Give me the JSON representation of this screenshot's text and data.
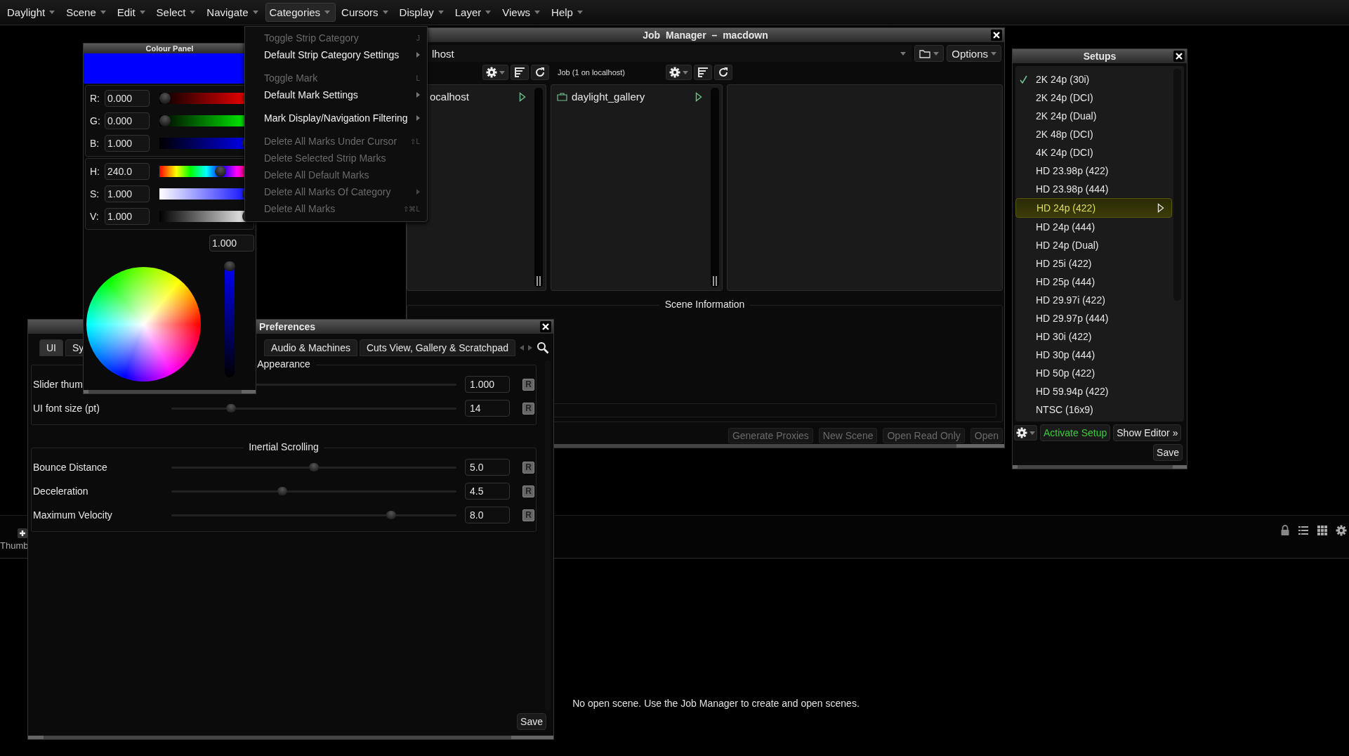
{
  "menubar": [
    {
      "label": "Daylight",
      "open": false
    },
    {
      "label": "Scene",
      "open": false
    },
    {
      "label": "Edit",
      "open": false
    },
    {
      "label": "Select",
      "open": false
    },
    {
      "label": "Navigate",
      "open": false
    },
    {
      "label": "Categories",
      "open": true
    },
    {
      "label": "Cursors",
      "open": false
    },
    {
      "label": "Display",
      "open": false
    },
    {
      "label": "Layer",
      "open": false
    },
    {
      "label": "Views",
      "open": false
    },
    {
      "label": "Help",
      "open": false
    }
  ],
  "categories_menu": {
    "items": [
      {
        "kind": "item",
        "label": "Toggle Strip Category",
        "disabled": true,
        "submenu": false,
        "shortcut": "J"
      },
      {
        "kind": "item",
        "label": "Default Strip Category Settings",
        "disabled": false,
        "submenu": true
      },
      {
        "kind": "separator"
      },
      {
        "kind": "item",
        "label": "Toggle Mark",
        "disabled": true,
        "submenu": false,
        "shortcut": "L"
      },
      {
        "kind": "item",
        "label": "Default Mark Settings",
        "disabled": false,
        "submenu": true
      },
      {
        "kind": "separator"
      },
      {
        "kind": "item",
        "label": "Mark Display/Navigation Filtering",
        "disabled": false,
        "submenu": true
      },
      {
        "kind": "separator"
      },
      {
        "kind": "item",
        "label": "Delete All Marks Under Cursor",
        "disabled": true,
        "submenu": false,
        "shortcut": "⇧L"
      },
      {
        "kind": "item",
        "label": "Delete Selected Strip Marks",
        "disabled": true,
        "submenu": false
      },
      {
        "kind": "item",
        "label": "Delete All Default Marks",
        "disabled": true,
        "submenu": false
      },
      {
        "kind": "item",
        "label": "Delete All Marks Of Category",
        "disabled": true,
        "submenu": true
      },
      {
        "kind": "item",
        "label": "Delete All Marks",
        "disabled": true,
        "submenu": false,
        "shortcut": "⇧⌘L"
      }
    ]
  },
  "colour_panel": {
    "title": "Colour Panel",
    "rgb": [
      {
        "label": "R:",
        "value": "0.000",
        "level": 0,
        "kind": "red"
      },
      {
        "label": "G:",
        "value": "0.000",
        "level": 0,
        "kind": "green"
      },
      {
        "label": "B:",
        "value": "1.000",
        "level": 1,
        "kind": "blue"
      }
    ],
    "hsv": [
      {
        "label": "H:",
        "value": "240.0",
        "level": 0.667,
        "kind": "hue"
      },
      {
        "label": "S:",
        "value": "1.000",
        "level": 1,
        "kind": "saturation"
      },
      {
        "label": "V:",
        "value": "1.000",
        "level": 1,
        "kind": "value"
      }
    ],
    "intensity": {
      "value": "1.000",
      "level": 1
    }
  },
  "job_manager": {
    "title": "Job Manager – macdown",
    "path": "lhost",
    "options_button": "Options",
    "job_label": "Job (1 on localhost)",
    "columns": [
      {
        "items": [
          {
            "label": "ocalhost",
            "kind": "host"
          }
        ]
      },
      {
        "items": [
          {
            "label": "daylight_gallery",
            "kind": "job"
          }
        ]
      }
    ],
    "scene_info": {
      "title": "Scene Information"
    },
    "buttons": [
      {
        "label": "Generate Proxies",
        "disabled": true
      },
      {
        "label": "New Scene",
        "disabled": true
      },
      {
        "label": "Open Read Only",
        "disabled": true
      },
      {
        "label": "Open",
        "disabled": true
      }
    ]
  },
  "setups": {
    "title": "Setups",
    "items": [
      {
        "label": "2K 24p (30i)",
        "checked": true,
        "selected": false
      },
      {
        "label": "2K 24p (DCI)",
        "checked": false,
        "selected": false
      },
      {
        "label": "2K 24p (Dual)",
        "checked": false,
        "selected": false
      },
      {
        "label": "2K 48p (DCI)",
        "checked": false,
        "selected": false
      },
      {
        "label": "4K 24p (DCI)",
        "checked": false,
        "selected": false
      },
      {
        "label": "HD 23.98p (422)",
        "checked": false,
        "selected": false
      },
      {
        "label": "HD 23.98p (444)",
        "checked": false,
        "selected": false
      },
      {
        "label": "HD 24p (422)",
        "checked": false,
        "selected": true
      },
      {
        "label": "HD 24p (444)",
        "checked": false,
        "selected": false
      },
      {
        "label": "HD 24p (Dual)",
        "checked": false,
        "selected": false
      },
      {
        "label": "HD 25i (422)",
        "checked": false,
        "selected": false
      },
      {
        "label": "HD 25p (444)",
        "checked": false,
        "selected": false
      },
      {
        "label": "HD 29.97i (422)",
        "checked": false,
        "selected": false
      },
      {
        "label": "HD 29.97p (444)",
        "checked": false,
        "selected": false
      },
      {
        "label": "HD 30i (422)",
        "checked": false,
        "selected": false
      },
      {
        "label": "HD 30p (444)",
        "checked": false,
        "selected": false
      },
      {
        "label": "HD 50p (422)",
        "checked": false,
        "selected": false
      },
      {
        "label": "HD 59.94p (422)",
        "checked": false,
        "selected": false
      },
      {
        "label": "NTSC (16x9)",
        "checked": false,
        "selected": false
      }
    ],
    "activate_button": "Activate Setup",
    "editor_button": "Show Editor »",
    "save_button": "Save"
  },
  "preferences": {
    "title": "Preferences",
    "tabs": [
      {
        "label": "UI",
        "selected": true
      },
      {
        "label": "Sy",
        "selected": false
      },
      {
        "label": "Audio & Machines",
        "selected": false
      },
      {
        "label": "Cuts View, Gallery & Scratchpad",
        "selected": false
      }
    ],
    "groups": [
      {
        "title": "Appearance",
        "rows": [
          {
            "label": "Slider thum",
            "value": "1.000",
            "reset": "R"
          },
          {
            "label": "UI font size (pt)",
            "value": "14",
            "level": 0.21,
            "reset": "R"
          }
        ]
      },
      {
        "title": "Inertial Scrolling",
        "rows": [
          {
            "label": "Bounce Distance",
            "value": "5.0",
            "level": 0.5,
            "reset": "R"
          },
          {
            "label": "Deceleration",
            "value": "4.5",
            "level": 0.39,
            "reset": "R"
          },
          {
            "label": "Maximum Velocity",
            "value": "8.0",
            "level": 0.77,
            "reset": "R"
          }
        ]
      }
    ],
    "save_button": "Save"
  },
  "workspace": {
    "thumb_tab": "Thumb",
    "message": "No open scene. Use the Job Manager to create and open scenes."
  }
}
